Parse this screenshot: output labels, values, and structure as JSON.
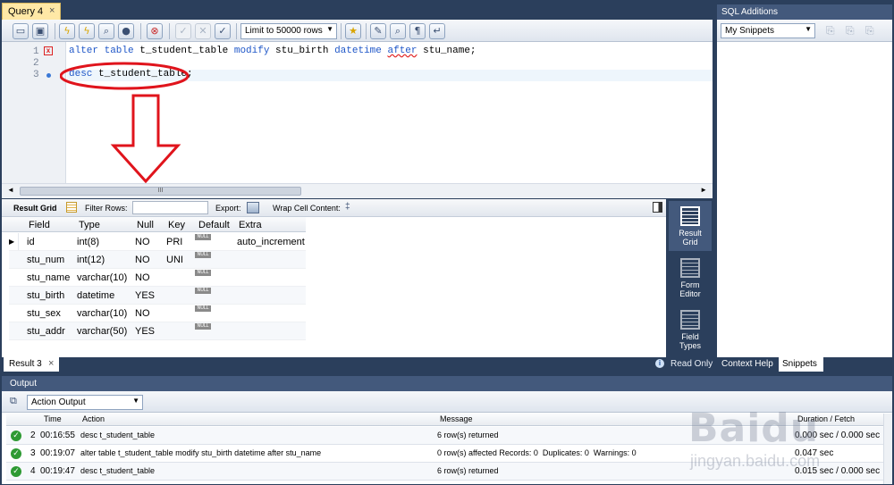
{
  "query_tab": {
    "label": "Query 4"
  },
  "toolbar": {
    "limit_select": "Limit to 50000 rows"
  },
  "editor": {
    "lines": [
      {
        "num": "1",
        "marker": "error",
        "text": "alter table t_student_table modify stu_birth datetime after stu_name;"
      },
      {
        "num": "2",
        "marker": "",
        "text": ""
      },
      {
        "num": "3",
        "marker": "dot",
        "text": "desc t_student_table;"
      }
    ],
    "scroll_grip": "III"
  },
  "result_toolbar": {
    "result_grid": "Result Grid",
    "filter_rows": "Filter Rows:",
    "filter_value": "",
    "export": "Export:",
    "wrap": "Wrap Cell Content:"
  },
  "grid": {
    "columns": [
      "Field",
      "Type",
      "Null",
      "Key",
      "Default",
      "Extra"
    ],
    "null_badge": "NULL",
    "rows": [
      [
        "id",
        "int(8)",
        "NO",
        "PRI",
        "NULL",
        "auto_increment"
      ],
      [
        "stu_num",
        "int(12)",
        "NO",
        "UNI",
        "NULL",
        ""
      ],
      [
        "stu_name",
        "varchar(10)",
        "NO",
        "",
        "NULL",
        ""
      ],
      [
        "stu_birth",
        "datetime",
        "YES",
        "",
        "NULL",
        ""
      ],
      [
        "stu_sex",
        "varchar(10)",
        "NO",
        "",
        "NULL",
        ""
      ],
      [
        "stu_addr",
        "varchar(50)",
        "YES",
        "",
        "NULL",
        ""
      ]
    ]
  },
  "side_panel": {
    "result_grid": [
      "Result",
      "Grid"
    ],
    "form_editor": [
      "Form",
      "Editor"
    ],
    "field_types": [
      "Field",
      "Types"
    ]
  },
  "result_tab": {
    "label": "Result 3"
  },
  "bottom_tabs": {
    "read_only": "Read Only",
    "context_help": "Context Help",
    "snippets": "Snippets"
  },
  "sql_additions": {
    "title": "SQL Additions",
    "select": "My Snippets"
  },
  "output": {
    "title": "Output",
    "select": "Action Output",
    "columns": {
      "time": "Time",
      "action": "Action",
      "message": "Message",
      "duration": "Duration / Fetch"
    },
    "rows": [
      {
        "num": "2",
        "time": "00:16:55",
        "action": "desc t_student_table",
        "message": "6 row(s) returned",
        "duration": "0.000 sec / 0.000 sec"
      },
      {
        "num": "3",
        "time": "00:19:07",
        "action": "alter table t_student_table modify stu_birth datetime after stu_name",
        "message": "0 row(s) affected Records: 0  Duplicates: 0  Warnings: 0",
        "duration": "0.047 sec"
      },
      {
        "num": "4",
        "time": "00:19:47",
        "action": "desc t_student_table",
        "message": "6 row(s) returned",
        "duration": "0.015 sec / 0.000 sec"
      }
    ]
  },
  "watermark": {
    "brand": "Baidu",
    "url": "jingyan.baidu.com"
  },
  "colors": {
    "frame": "#2b3f5c",
    "keyword": "#1f57c8",
    "annotation": "#e0141c",
    "ok": "#2e9a33"
  }
}
